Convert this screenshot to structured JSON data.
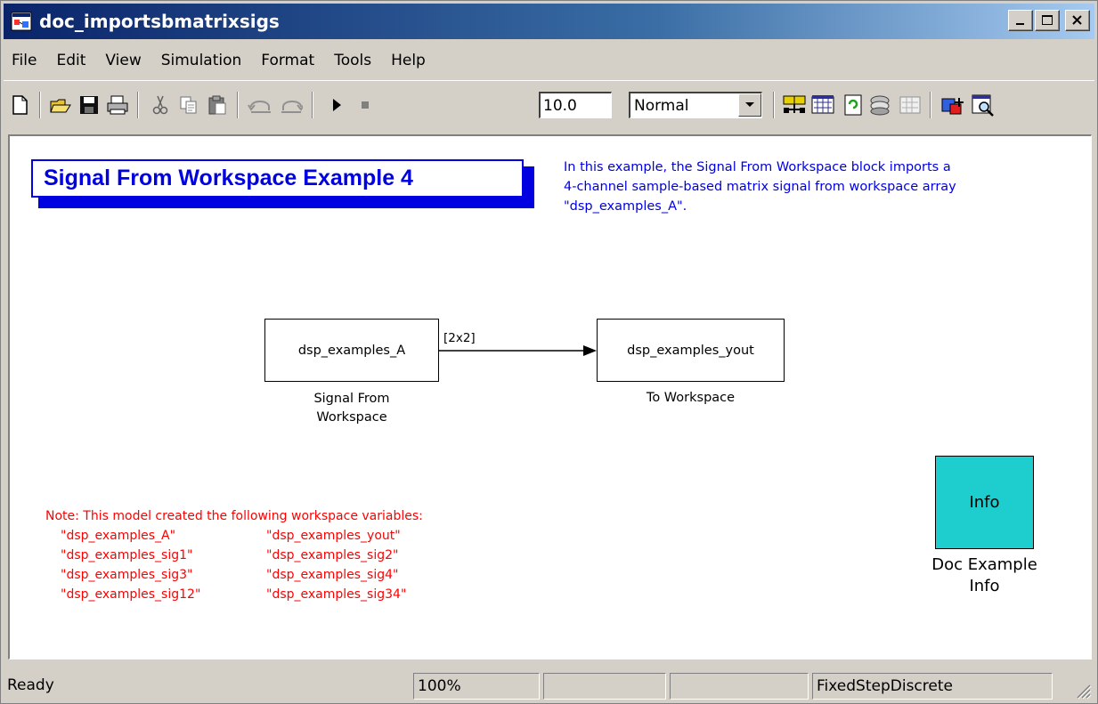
{
  "window": {
    "title": "doc_importsbmatrixsigs",
    "controls": {
      "minimize": "_",
      "maximize": "□",
      "close": "✕"
    }
  },
  "menubar": {
    "items": [
      {
        "label": "File"
      },
      {
        "label": "Edit"
      },
      {
        "label": "View"
      },
      {
        "label": "Simulation"
      },
      {
        "label": "Format"
      },
      {
        "label": "Tools"
      },
      {
        "label": "Help"
      }
    ]
  },
  "toolbar": {
    "icons": [
      "new-model-icon",
      "open-icon",
      "save-icon",
      "print-icon",
      "cut-icon",
      "copy-icon",
      "paste-icon",
      "undo-icon",
      "redo-icon",
      "start-simulation-icon",
      "stop-simulation-icon",
      "build-model-icon",
      "incremental-build-icon",
      "refresh-icon",
      "update-diagram-icon",
      "model-advisor-icon",
      "library-browser-icon",
      "model-explorer-icon"
    ],
    "stop_time": "10.0",
    "sim_mode": "Normal"
  },
  "canvas": {
    "model_title": "Signal From Workspace Example 4",
    "description": [
      "In this example, the Signal From Workspace block imports a",
      "4-channel sample-based matrix signal from workspace array",
      "\"dsp_examples_A\"."
    ],
    "source_block": {
      "text": "dsp_examples_A",
      "label_lines": [
        "Signal From",
        "Workspace"
      ]
    },
    "signal_dims": "[2x2]",
    "sink_block": {
      "text": "dsp_examples_yout",
      "label": "To Workspace"
    },
    "note": {
      "heading": "Note: This model created the following workspace variables:",
      "rows": [
        [
          "\"dsp_examples_A\"",
          "\"dsp_examples_yout\""
        ],
        [
          "\"dsp_examples_sig1\"",
          "\"dsp_examples_sig2\""
        ],
        [
          "\"dsp_examples_sig3\"",
          "\"dsp_examples_sig4\""
        ],
        [
          "\"dsp_examples_sig12\"",
          "\"dsp_examples_sig34\""
        ]
      ]
    },
    "info_block": {
      "text": "Info",
      "label_lines": [
        "Doc Example",
        "Info"
      ]
    }
  },
  "statusbar": {
    "status": "Ready",
    "zoom": "100%",
    "solver": "FixedStepDiscrete"
  },
  "colors": {
    "title_blue": "#0000e0",
    "note_red": "#ff0000",
    "info_cyan": "#1ecdcd"
  }
}
